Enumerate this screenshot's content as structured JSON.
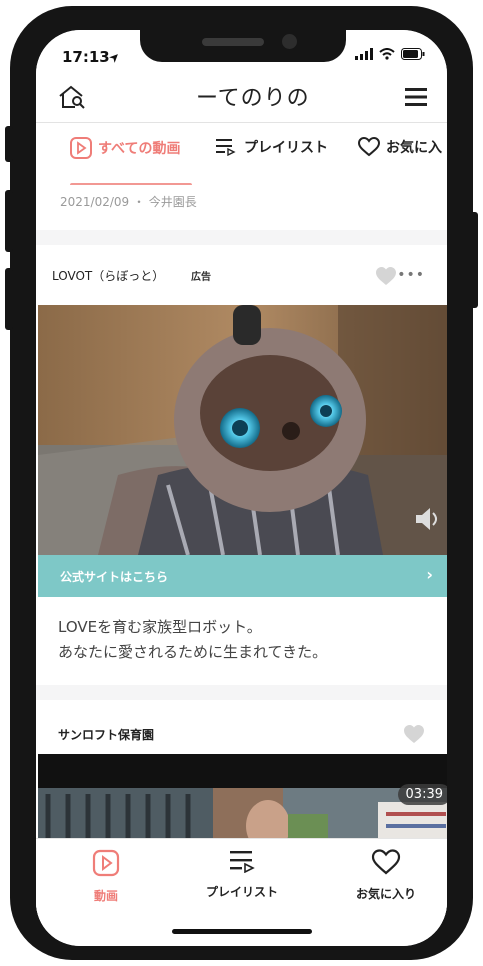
{
  "status_bar": {
    "time": "17:13"
  },
  "header": {
    "logo_text": "ーてのりの"
  },
  "tabs": [
    {
      "label": "すべての動画",
      "icon": "play-icon",
      "active": true
    },
    {
      "label": "プレイリスト",
      "icon": "playlist-icon",
      "active": false
    },
    {
      "label": "お気に入",
      "icon": "heart-icon",
      "active": false
    }
  ],
  "prev_post": {
    "meta": "2021/02/09 ・ 今井園長"
  },
  "ad_card": {
    "title": "LOVOT（らぼっと）",
    "badge": "広告",
    "cta_label": "公式サイトはこちら",
    "cta_chevron": "›",
    "description_line1": "LOVEを育む家族型ロボット。",
    "description_line2": "あなたに愛されるために生まれてきた。"
  },
  "video_card": {
    "channel": "サンロフト保育園",
    "duration": "03:39"
  },
  "bottom_nav": [
    {
      "label": "動画",
      "icon": "play-icon",
      "active": true
    },
    {
      "label": "プレイリスト",
      "icon": "playlist-icon",
      "active": false
    },
    {
      "label": "お気に入り",
      "icon": "heart-icon",
      "active": false
    }
  ],
  "colors": {
    "accent": "#ef7d78",
    "cta": "#7ec8c7",
    "frame": "#151515"
  }
}
